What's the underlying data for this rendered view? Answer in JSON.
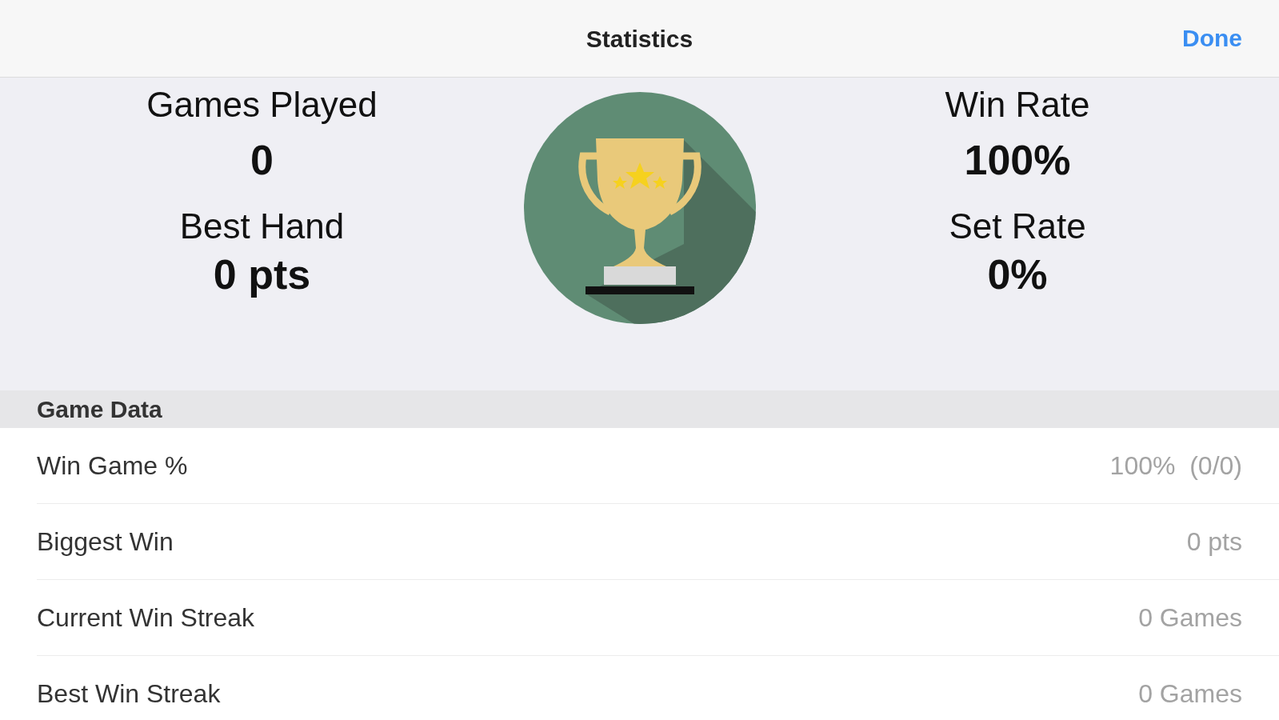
{
  "nav_bar": {
    "title": "Statistics",
    "done_button": "Done"
  },
  "summary": {
    "left": [
      {
        "label": "Games Played",
        "value": "0"
      },
      {
        "label": "Best Hand",
        "value": "0 pts"
      }
    ],
    "right": [
      {
        "label": "Win Rate",
        "value": "100%"
      },
      {
        "label": "Set Rate",
        "value": "0%"
      }
    ]
  },
  "section": {
    "title": "Game Data",
    "rows": [
      {
        "label": "Win Game %",
        "value": "100%  (0/0)"
      },
      {
        "label": "Biggest Win",
        "value": "0 pts"
      },
      {
        "label": "Current Win Streak",
        "value": "0 Games"
      },
      {
        "label": "Best Win Streak",
        "value": "0 Games"
      }
    ]
  }
}
